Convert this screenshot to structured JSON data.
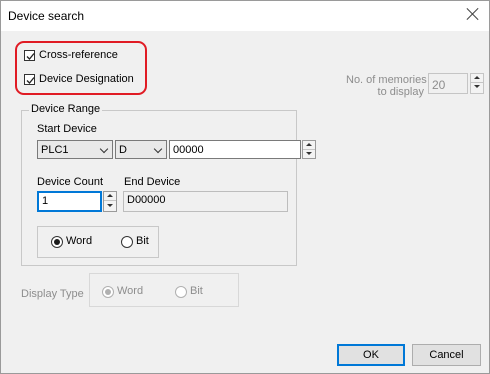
{
  "window": {
    "title": "Device search"
  },
  "options": {
    "cross_reference": {
      "label": "Cross-reference",
      "checked": true
    },
    "device_designation": {
      "label": "Device Designation",
      "checked": true
    }
  },
  "memories": {
    "label_line1": "No. of memories",
    "label_line2": "to display",
    "value": "20"
  },
  "device_range": {
    "title": "Device Range",
    "start_device_label": "Start Device",
    "plc_value": "PLC1",
    "device_type_value": "D",
    "start_address": "00000",
    "device_count_label": "Device Count",
    "device_count_value": "1",
    "end_device_label": "End Device",
    "end_device_value": "D00000",
    "word_label": "Word",
    "bit_label": "Bit",
    "word_selected": true
  },
  "display_type": {
    "label": "Display Type",
    "word_label": "Word",
    "bit_label": "Bit",
    "word_selected": true
  },
  "buttons": {
    "ok": "OK",
    "cancel": "Cancel"
  },
  "colors": {
    "highlight": "#e01b24",
    "focus": "#0078d7"
  }
}
